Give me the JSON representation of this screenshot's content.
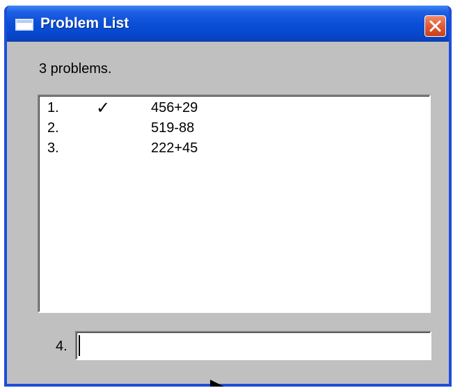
{
  "window": {
    "title": "Problem List"
  },
  "summary": "3 problems.",
  "problems": [
    {
      "number": "1.",
      "status": "✓",
      "expression": "456+29"
    },
    {
      "number": "2.",
      "status": "",
      "expression": "519-88"
    },
    {
      "number": "3.",
      "status": "",
      "expression": "222+45"
    }
  ],
  "entry": {
    "label": "4.",
    "value": ""
  },
  "colors": {
    "titlebar": "#0a4fd8",
    "window_bg": "#c0c0c0",
    "close_button": "#e05a34"
  },
  "icons": {
    "window": "window-icon",
    "close": "close-icon",
    "check": "checkmark-icon",
    "pointer": "mouse-pointer-icon"
  }
}
